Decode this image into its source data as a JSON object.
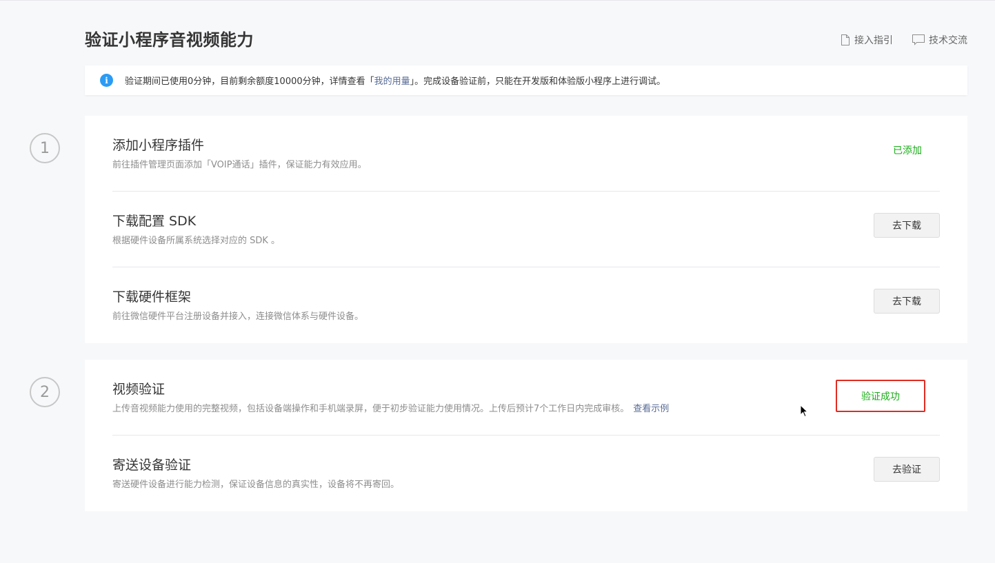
{
  "page": {
    "title": "验证小程序音视频能力"
  },
  "header_links": [
    {
      "label": "接入指引",
      "icon": "document-icon"
    },
    {
      "label": "技术交流",
      "icon": "chat-icon"
    }
  ],
  "notice": {
    "text_before": "验证期间已使用0分钟，目前剩余额度10000分钟，详情查看「",
    "link": "我的用量",
    "text_after": "」。完成设备验证前，只能在开发版和体验版小程序上进行调试。",
    "icon_glyph": "i"
  },
  "steps": [
    {
      "number": "1",
      "items": [
        {
          "title": "添加小程序插件",
          "desc": "前往插件管理页面添加「VOIP通话」插件，保证能力有效应用。",
          "status": "已添加"
        },
        {
          "title": "下载配置 SDK",
          "desc": "根据硬件设备所属系统选择对应的 SDK 。",
          "button": "去下载"
        },
        {
          "title": "下载硬件框架",
          "desc": "前往微信硬件平台注册设备并接入，连接微信体系与硬件设备。",
          "button": "去下载"
        }
      ]
    },
    {
      "number": "2",
      "items": [
        {
          "title": "视频验证",
          "desc": "上传音视频能力使用的完整视频，包括设备端操作和手机端录屏，便于初步验证能力使用情况。上传后预计7个工作日内完成审核。",
          "link": "查看示例",
          "status": "验证成功"
        },
        {
          "title": "寄送设备验证",
          "desc": "寄送硬件设备进行能力检测，保证设备信息的真实性，设备将不再寄回。",
          "button": "去验证"
        }
      ]
    }
  ],
  "colors": {
    "success": "#1aad19",
    "link": "#576b95",
    "info": "#2b9bf4",
    "highlight": "#e02b21"
  }
}
